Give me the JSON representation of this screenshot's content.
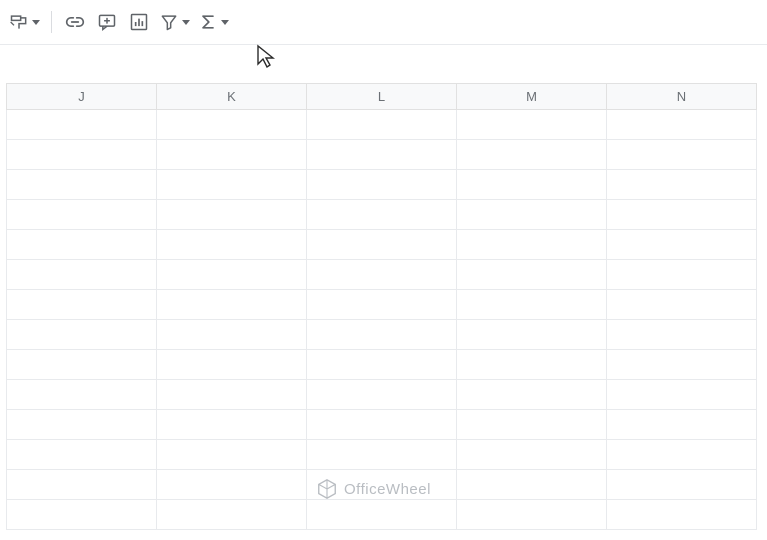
{
  "toolbar": {
    "items": [
      {
        "name": "paint-format",
        "has_dropdown": true
      },
      {
        "name": "separator"
      },
      {
        "name": "insert-link"
      },
      {
        "name": "insert-comment"
      },
      {
        "name": "insert-chart"
      },
      {
        "name": "filter",
        "has_dropdown": true
      },
      {
        "name": "functions",
        "has_dropdown": true
      }
    ]
  },
  "grid": {
    "columns": [
      "J",
      "K",
      "L",
      "M",
      "N"
    ],
    "visible_row_count": 14
  },
  "watermark": {
    "text": "OfficeWheel"
  }
}
